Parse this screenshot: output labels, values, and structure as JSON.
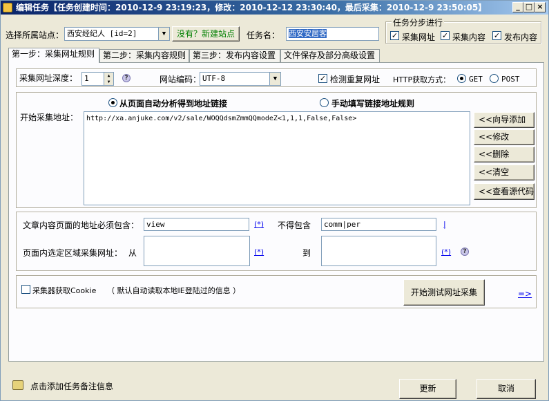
{
  "window": {
    "title": "编辑任务【任务创建时间：2010-12-9 23:19:23，修改：2010-12-12 23:30:40，最后采集：2010-12-9 23:50:05】",
    "min_label": "_",
    "max_label": "□",
    "close_label": "×"
  },
  "top": {
    "site_label": "选择所属站点：",
    "site_value": "西安经纪人 [id=2]",
    "new_site_button": "没有？新建站点",
    "task_name_label": "任务名：",
    "task_name_value": "西安安居客",
    "steps_group_title": "任务分步进行",
    "steps": [
      {
        "label": "采集网址",
        "checked": true
      },
      {
        "label": "采集内容",
        "checked": true
      },
      {
        "label": "发布内容",
        "checked": true
      }
    ]
  },
  "tabs": [
    {
      "label": "第一步：采集网址规则",
      "active": true
    },
    {
      "label": "第二步：采集内容规则",
      "active": false
    },
    {
      "label": "第三步：发布内容设置",
      "active": false
    },
    {
      "label": "文件保存及部分高级设置",
      "active": false
    }
  ],
  "step1": {
    "depth_label": "采集网址深度：",
    "depth_value": "1",
    "encoding_label": "网站编码：",
    "encoding_value": "UTF-8",
    "check_dup_label": "检测重复网址",
    "check_dup_checked": true,
    "http_method_label": "HTTP获取方式：",
    "http_get_label": "GET",
    "http_post_label": "POST",
    "http_selected": "GET",
    "mode_auto_label": "从页面自动分析得到地址链接",
    "mode_manual_label": "手动填写链接地址规则",
    "start_url_label": "开始采集地址：",
    "start_url_value": "http://xa.anjuke.com/v2/sale/WOQQdsmZmmQQmodeZ<1,1,1,False,False>",
    "side_buttons": [
      "<<向导添加",
      "<<修改",
      "<<删除",
      "<<清空",
      "<<查看源代码"
    ],
    "must_contain_label": "文章内容页面的地址必须包含：",
    "must_contain_value": "view",
    "must_contain_link": "(*)",
    "not_contain_label": "不得包含",
    "not_contain_value": "comm|per",
    "not_contain_link": "|",
    "region_label": "页面内选定区域采集网址：",
    "from_label": "从",
    "from_link": "(*)",
    "to_label": "到",
    "to_link": "(*)",
    "cookie_label": "采集器获取Cookie",
    "cookie_checked": false,
    "cookie_hint": "（ 默认自动读取本地IE登陆过的信息 ）",
    "test_button": "开始测试网址采集",
    "arrow_link": "=>",
    "help_glyph": "?"
  },
  "bottom": {
    "note_link": "点击添加任务备注信息",
    "update_button": "更新",
    "cancel_button": "取消"
  }
}
